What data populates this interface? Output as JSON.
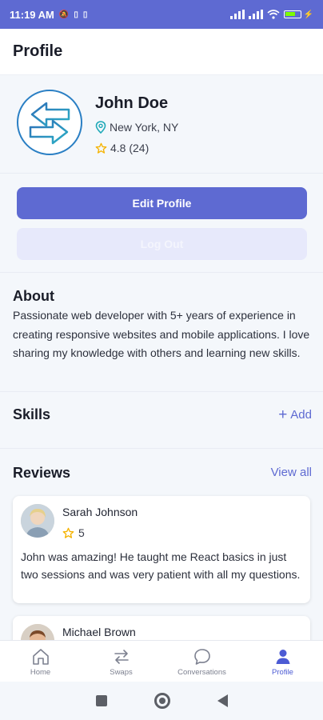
{
  "status_bar": {
    "time": "11:19 AM",
    "battery_level": 0.75
  },
  "app_bar": {
    "title": "Profile"
  },
  "profile": {
    "name": "John Doe",
    "location": "New York, NY",
    "rating": "4.8 (24)",
    "edit_label": "Edit Profile",
    "logout_label": "Log Out"
  },
  "about": {
    "title": "About",
    "text": "Passionate web developer with 5+ years of experience in creating responsive websites and mobile applications. I love sharing my knowledge with others and learning new skills."
  },
  "skills": {
    "title": "Skills",
    "add_label": "Add"
  },
  "reviews": {
    "title": "Reviews",
    "view_all_label": "View all",
    "items": [
      {
        "name": "Sarah Johnson",
        "rating": "5",
        "text": "John was amazing! He taught me React basics in just two sessions and was very patient with all my questions."
      },
      {
        "name": "Michael Brown"
      }
    ]
  },
  "bottom_nav": {
    "items": [
      {
        "label": "Home",
        "icon": "home-icon"
      },
      {
        "label": "Swaps",
        "icon": "swap-icon"
      },
      {
        "label": "Conversations",
        "icon": "chat-icon"
      },
      {
        "label": "Profile",
        "icon": "person-icon"
      }
    ],
    "active": "Profile"
  },
  "colors": {
    "accent": "#5e6ad2",
    "star": "#f5b301",
    "location_pin": "#1fa9b8"
  }
}
